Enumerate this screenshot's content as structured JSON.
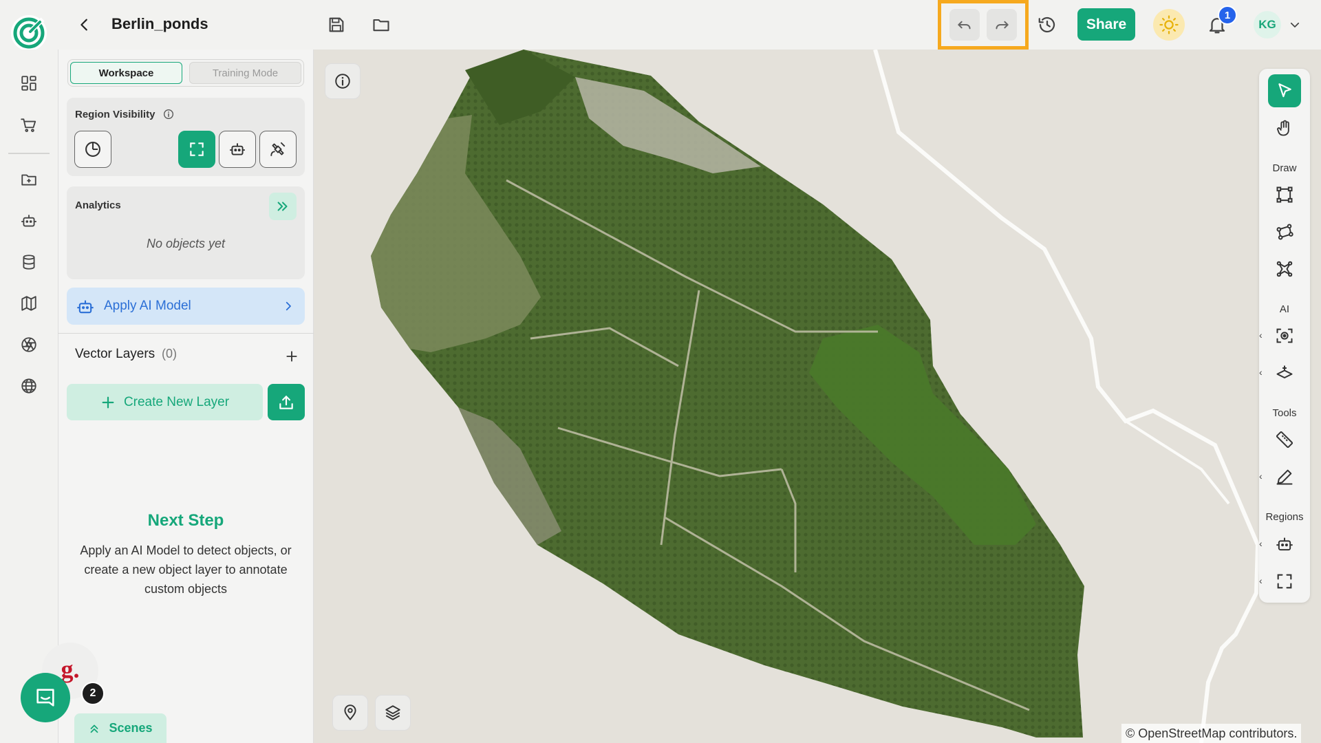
{
  "header": {
    "project_name": "Berlin_ponds",
    "share_label": "Share",
    "notification_count": "1",
    "avatar_initials": "KG"
  },
  "icons": {
    "logo": "app-logo-icon",
    "back": "chevron-left-icon",
    "save": "save-icon",
    "open": "folder-icon",
    "undo": "undo-icon",
    "redo": "redo-icon",
    "history": "history-icon",
    "theme": "sun-icon",
    "notifications": "bell-icon",
    "account_menu": "chevron-down-icon"
  },
  "rail": {
    "items": [
      "dashboard-icon",
      "cart-icon",
      "project-folder-icon",
      "ai-robot-icon",
      "database-icon",
      "map-icon",
      "aperture-icon",
      "globe-icon"
    ]
  },
  "panel": {
    "modes": {
      "workspace": "Workspace",
      "training": "Training Mode"
    },
    "region_visibility": {
      "title": "Region Visibility",
      "buttons": [
        "clock-icon",
        "expand-icon",
        "robot-icon",
        "satellite-icon"
      ]
    },
    "analytics": {
      "title": "Analytics",
      "empty": "No objects yet"
    },
    "apply_ai": "Apply AI Model",
    "vector_layers": {
      "title": "Vector Layers",
      "count": "(0)"
    },
    "create_layer": "Create New Layer",
    "next_step": {
      "title": "Next Step",
      "description": "Apply an AI Model to detect objects, or create a new object layer to annotate custom objects"
    },
    "chat_badge_count": "2",
    "scenes_label": "Scenes"
  },
  "map": {
    "attribution": "© OpenStreetMap contributors."
  },
  "toolbar": {
    "sections": {
      "draw": "Draw",
      "ai": "AI",
      "tools": "Tools",
      "regions": "Regions"
    }
  },
  "colors": {
    "accent": "#16a77a",
    "highlight": "#f6a91e",
    "notification": "#2563eb",
    "ai_button": "#d4e6f8"
  }
}
